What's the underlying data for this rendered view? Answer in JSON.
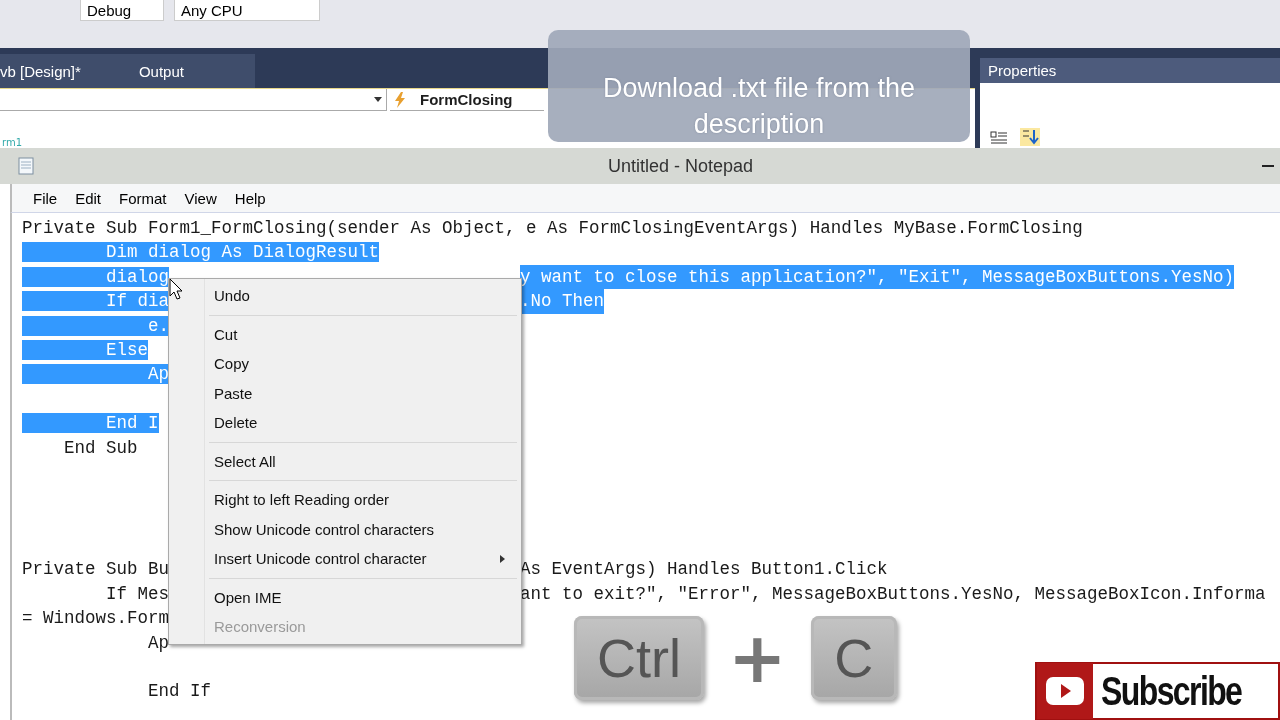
{
  "vs": {
    "toolbar": {
      "configuration": "Debug",
      "platform": "Any CPU"
    },
    "tabs": [
      "vb [Design]*",
      "Output"
    ],
    "event_dropdown": {
      "value": "FormClosing"
    },
    "margin_text": "rm1",
    "properties": {
      "title": "Properties"
    }
  },
  "callout": {
    "text": "Download .txt file from the description"
  },
  "notepad": {
    "title": "Untitled - Notepad",
    "menu": [
      "File",
      "Edit",
      "Format",
      "View",
      "Help"
    ],
    "lines": [
      {
        "kind": "code",
        "segments": [
          {
            "text": "Private Sub Form1_FormClosing(sender As Object, e As FormClosingEventArgs) Handles MyBase.FormClosing",
            "selected": false
          }
        ]
      },
      {
        "kind": "code",
        "segments": [
          {
            "text": "        Dim dialog As DialogResult",
            "selected": true
          }
        ]
      },
      {
        "kind": "code",
        "segments": [
          {
            "text": "        dialog",
            "selected": true
          },
          {
            "text": "y want to close this application?\", \"Exit\", MessageBoxButtons.YesNo)",
            "selected": true,
            "after_menu": true
          }
        ]
      },
      {
        "kind": "code",
        "segments": [
          {
            "text": "        If dia",
            "selected": true
          },
          {
            "text": ".No Then",
            "selected": true,
            "after_menu": true
          }
        ]
      },
      {
        "kind": "code",
        "segments": [
          {
            "text": "            e.",
            "selected": true
          }
        ]
      },
      {
        "kind": "code",
        "segments": [
          {
            "text": "        Else",
            "selected": true
          }
        ]
      },
      {
        "kind": "code",
        "segments": [
          {
            "text": "            Ap",
            "selected": true
          }
        ]
      },
      {
        "kind": "blank"
      },
      {
        "kind": "code",
        "segments": [
          {
            "text": "        End I",
            "selected": true
          }
        ]
      },
      {
        "kind": "code",
        "segments": [
          {
            "text": "    End Sub",
            "selected": false
          }
        ]
      },
      {
        "kind": "blank"
      },
      {
        "kind": "blank"
      },
      {
        "kind": "blank"
      },
      {
        "kind": "blank"
      },
      {
        "kind": "code",
        "segments": [
          {
            "text": "Private Sub Bu",
            "selected": false
          },
          {
            "text": "As EventArgs) Handles Button1.Click",
            "selected": false,
            "after_menu": true
          }
        ]
      },
      {
        "kind": "code",
        "segments": [
          {
            "text": "        If Mes",
            "selected": false
          },
          {
            "text": "ant to exit?\", \"Error\", MessageBoxButtons.YesNo, MessageBoxIcon.Informa",
            "selected": false,
            "after_menu": true
          }
        ]
      },
      {
        "kind": "code",
        "segments": [
          {
            "text": "= Windows.Form",
            "selected": false
          }
        ]
      },
      {
        "kind": "code",
        "segments": [
          {
            "text": "            Ap",
            "selected": false
          }
        ]
      },
      {
        "kind": "blank"
      },
      {
        "kind": "code",
        "segments": [
          {
            "text": "            End If",
            "selected": false
          }
        ]
      }
    ]
  },
  "context_menu": [
    {
      "kind": "item",
      "label": "Undo",
      "disabled": false
    },
    {
      "kind": "separator"
    },
    {
      "kind": "item",
      "label": "Cut",
      "disabled": false
    },
    {
      "kind": "item",
      "label": "Copy",
      "disabled": false
    },
    {
      "kind": "item",
      "label": "Paste",
      "disabled": false
    },
    {
      "kind": "item",
      "label": "Delete",
      "disabled": false
    },
    {
      "kind": "separator"
    },
    {
      "kind": "item",
      "label": "Select All",
      "disabled": false
    },
    {
      "kind": "separator"
    },
    {
      "kind": "item",
      "label": "Right to left Reading order",
      "disabled": false
    },
    {
      "kind": "item",
      "label": "Show Unicode control characters",
      "disabled": false
    },
    {
      "kind": "item",
      "label": "Insert Unicode control character",
      "disabled": false,
      "submenu": true
    },
    {
      "kind": "separator"
    },
    {
      "kind": "item",
      "label": "Open IME",
      "disabled": false
    },
    {
      "kind": "item",
      "label": "Reconversion",
      "disabled": true
    }
  ],
  "shortcut": {
    "keys": [
      "Ctrl",
      "C"
    ],
    "joiner": "+"
  },
  "subscribe": {
    "label": "Subscribe"
  }
}
